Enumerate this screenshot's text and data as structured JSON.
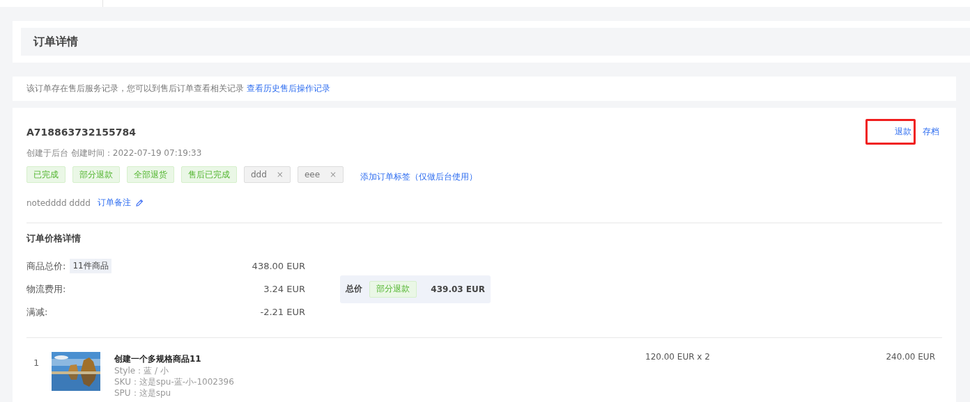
{
  "page_title": "订单详情",
  "notice": {
    "text": "该订单存在售后服务记录，您可以到售后订单查看相关记录",
    "link": "查看历史售后操作记录"
  },
  "order": {
    "number": "A718863732155784",
    "meta": "创建于后台 创建时间：2022-07-19 07:19:33",
    "actions": [
      {
        "label": "退款",
        "highlighted": true
      },
      {
        "label": "存档",
        "highlighted": false
      }
    ],
    "tags": [
      {
        "label": "已完成",
        "kind": "status"
      },
      {
        "label": "部分退款",
        "kind": "status"
      },
      {
        "label": "全部退货",
        "kind": "status"
      },
      {
        "label": "售后已完成",
        "kind": "status"
      },
      {
        "label": "ddd",
        "kind": "custom",
        "close": "×"
      },
      {
        "label": "eee",
        "kind": "custom",
        "close": "×"
      }
    ],
    "add_tag": "添加订单标签（仅做后台使用）",
    "note": "notedddd dddd",
    "note_link": "订单备注"
  },
  "price": {
    "title": "订单价格详情",
    "rows": [
      {
        "label": "商品总价:",
        "badge": "11件商品",
        "value": "438.00 EUR"
      },
      {
        "label": "物流费用:",
        "value": "3.24 EUR"
      },
      {
        "label": "满减:",
        "value": "-2.21 EUR"
      }
    ],
    "total": {
      "label": "总价",
      "status": "部分退款",
      "value": "439.03 EUR"
    }
  },
  "items": [
    {
      "index": "1",
      "name": "创建一个多规格商品11",
      "style": "Style：蓝 / 小",
      "sku": "SKU：这是spu-蓝-小-1002396",
      "spu": "SPU：这是spu",
      "unit": "120.00 EUR x 2",
      "amount": "240.00 EUR"
    }
  ]
}
